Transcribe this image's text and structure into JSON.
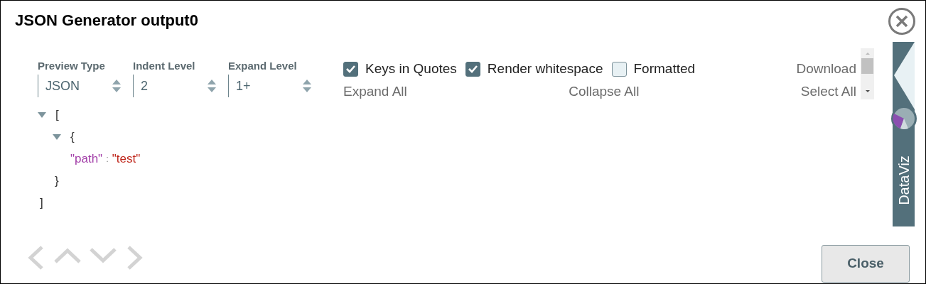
{
  "window": {
    "title": "JSON Generator output0"
  },
  "selects": [
    {
      "label": "Preview Type",
      "value": "JSON"
    },
    {
      "label": "Indent Level",
      "value": "2"
    },
    {
      "label": "Expand Level",
      "value": "1+"
    }
  ],
  "checkboxes": [
    {
      "label": "Keys in Quotes",
      "checked": true
    },
    {
      "label": "Render whitespace",
      "checked": true
    },
    {
      "label": "Formatted",
      "checked": false
    }
  ],
  "download_link": "Download",
  "actions": [
    "Expand All",
    "Collapse All",
    "Select All"
  ],
  "tree": {
    "open": "[",
    "close": "]",
    "expanded": true,
    "children": [
      {
        "open": "{",
        "close": "}",
        "expanded": true,
        "children": [
          {
            "key": "\"path\"",
            "separator": ":",
            "value": "\"test\""
          }
        ]
      }
    ]
  },
  "side_tab": {
    "label": "DataViz"
  },
  "footer": {
    "close_button": "Close"
  }
}
